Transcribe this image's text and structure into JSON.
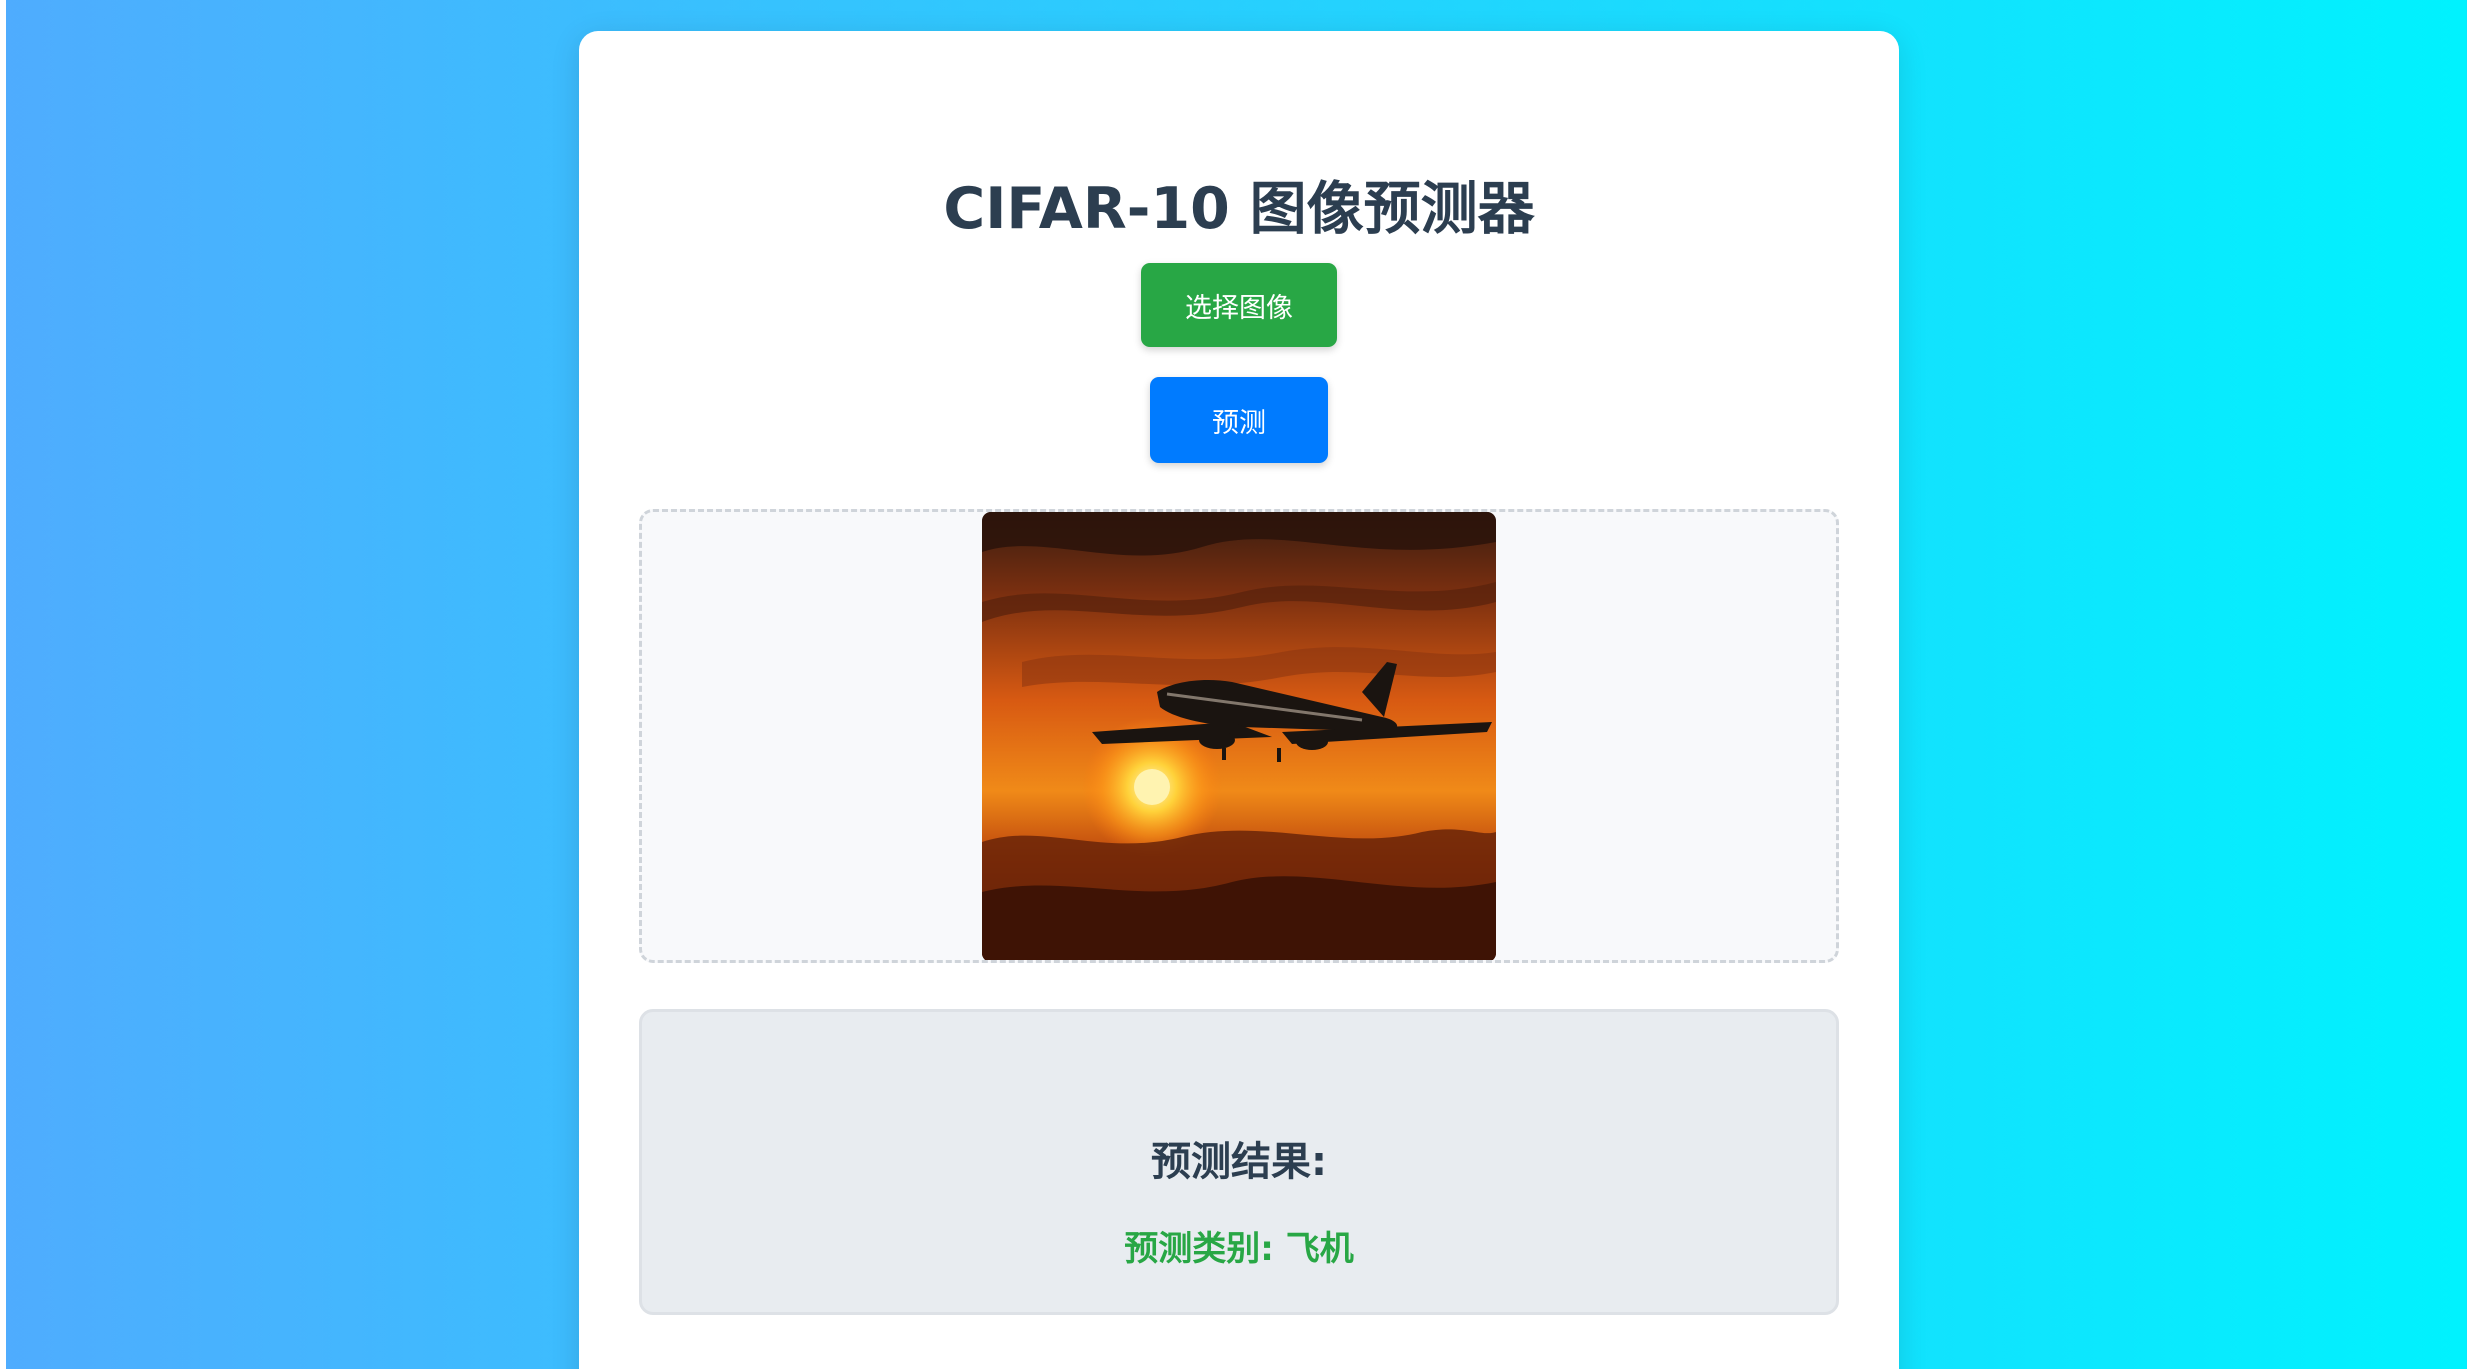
{
  "page": {
    "title": "CIFAR-10 图像预测器"
  },
  "controls": {
    "choose_label": "选择图像",
    "predict_label": "预测"
  },
  "preview": {
    "image_description": "airplane-sunset-photo"
  },
  "result": {
    "heading": "预测结果:",
    "prediction_text": "预测类别: 飞机"
  },
  "colors": {
    "background_gradient_start": "#4facfe",
    "background_gradient_end": "#00f2fe",
    "title_color": "#2c3e50",
    "choose_button": "#28a745",
    "predict_button": "#007bff",
    "prediction_text": "#28a745"
  }
}
